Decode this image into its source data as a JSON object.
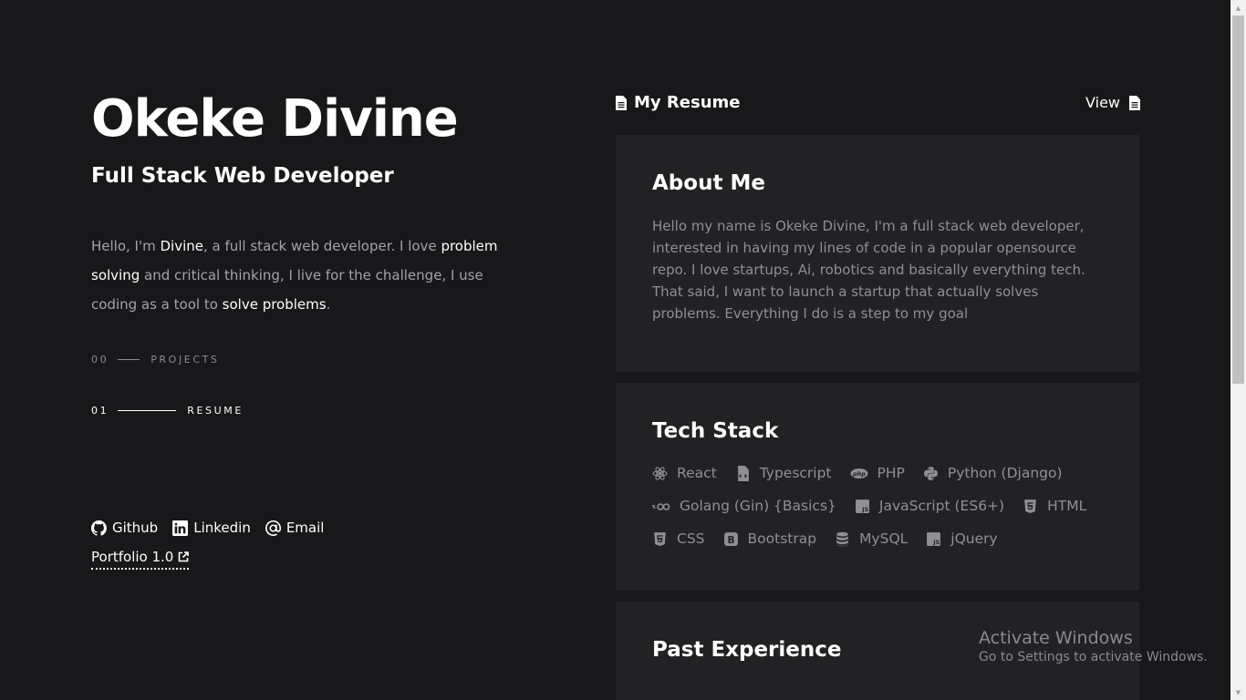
{
  "profile": {
    "name": "Okeke Divine",
    "role": "Full Stack Web Developer",
    "intro": {
      "p1": "Hello, I'm ",
      "name": "Divine",
      "p2": ", a full stack web developer. I love ",
      "h1": "problem solving",
      "p3": " and critical thinking, I live for the challenge, I use coding as a tool to ",
      "h2": "solve problems",
      "p4": "."
    }
  },
  "nav": [
    {
      "num": "00",
      "label": "PROJECTS",
      "active": false
    },
    {
      "num": "01",
      "label": "RESUME",
      "active": true
    }
  ],
  "socials": {
    "github": "Github",
    "linkedin": "Linkedin",
    "email": "Email",
    "portfolio": "Portfolio 1.0"
  },
  "resume": {
    "title": "My Resume",
    "view": "View"
  },
  "about": {
    "heading": "About Me",
    "text": "Hello my name is Okeke Divine, I'm a full stack web developer, interested in having my lines of code in a popular opensource repo. I love startups, Ai, robotics and basically everything tech. That said, I want to launch a startup that actually solves problems. Everything I do is a step to my goal"
  },
  "stack": {
    "heading": "Tech Stack",
    "items": [
      {
        "label": "React",
        "icon": "react-icon"
      },
      {
        "label": "Typescript",
        "icon": "typescript-icon"
      },
      {
        "label": "PHP",
        "icon": "php-icon"
      },
      {
        "label": "Python (Django)",
        "icon": "python-icon"
      },
      {
        "label": "Golang (Gin) {Basics}",
        "icon": "golang-icon"
      },
      {
        "label": "JavaScript (ES6+)",
        "icon": "javascript-icon"
      },
      {
        "label": "HTML",
        "icon": "html5-icon"
      },
      {
        "label": "CSS",
        "icon": "css3-icon"
      },
      {
        "label": "Bootstrap",
        "icon": "bootstrap-icon"
      },
      {
        "label": "MySQL",
        "icon": "database-icon"
      },
      {
        "label": "jQuery",
        "icon": "jquery-icon"
      }
    ]
  },
  "experience": {
    "heading": "Past Experience"
  },
  "overlay": {
    "title": "Activate Windows",
    "subtitle": "Go to Settings to activate Windows."
  },
  "colors": {
    "background": "#18171a",
    "card": "#222225",
    "text_muted": "#8f8f96",
    "text_primary": "#ffffff"
  }
}
